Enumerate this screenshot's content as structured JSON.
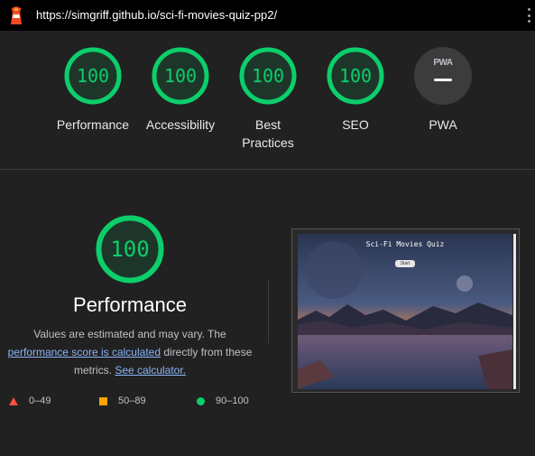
{
  "url_bar": {
    "url": "https://simgriff.github.io/sci-fi-movies-quiz-pp2/",
    "logo_icon": "lighthouse-icon",
    "menu_icon": "kebab-menu-icon"
  },
  "gauges": [
    {
      "score": "100",
      "label": "Performance"
    },
    {
      "score": "100",
      "label": "Accessibility"
    },
    {
      "score": "100",
      "label": "Best Practices"
    },
    {
      "score": "100",
      "label": "SEO"
    }
  ],
  "pwa": {
    "badge_text": "PWA",
    "label": "PWA"
  },
  "performance": {
    "score": "100",
    "title": "Performance",
    "desc_prefix": "Values are estimated and may vary. The ",
    "desc_link1": "performance score is calculated",
    "desc_middle": " directly from these metrics. ",
    "desc_link2": "See calculator."
  },
  "legend": [
    {
      "shape": "triangle",
      "range": "0–49",
      "color": "#ff4e42"
    },
    {
      "shape": "square",
      "range": "50–89",
      "color": "#ffa400"
    },
    {
      "shape": "circle",
      "range": "90–100",
      "color": "#0cce6b"
    }
  ],
  "thumbnail": {
    "title": "Sci-Fi Movies Quiz",
    "button_label": "Start"
  },
  "colors": {
    "pass": "#0cce6b",
    "background": "#212121",
    "link": "#8ab4f8"
  }
}
